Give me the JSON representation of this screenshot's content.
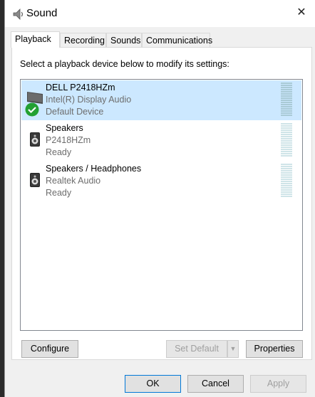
{
  "window": {
    "title": "Sound",
    "close_label": "✕"
  },
  "tabs": [
    {
      "label": "Playback"
    },
    {
      "label": "Recording"
    },
    {
      "label": "Sounds"
    },
    {
      "label": "Communications"
    }
  ],
  "instruction": "Select a playback device below to modify its settings:",
  "devices": [
    {
      "name": "DELL P2418HZm",
      "driver": "Intel(R) Display Audio",
      "status": "Default Device",
      "icon": "monitor-icon",
      "default_check": "check-icon"
    },
    {
      "name": "Speakers",
      "driver": "P2418HZm",
      "status": "Ready",
      "icon": "speaker-icon"
    },
    {
      "name": "Speakers / Headphones",
      "driver": "Realtek Audio",
      "status": "Ready",
      "icon": "speaker-icon"
    }
  ],
  "buttons": {
    "configure": "Configure",
    "set_default": "Set Default",
    "set_default_arrow": "▼",
    "properties": "Properties",
    "ok": "OK",
    "cancel": "Cancel",
    "apply": "Apply"
  },
  "colors": {
    "selection": "#cce8ff",
    "accent": "#0078d7",
    "check_green": "#22a032"
  }
}
